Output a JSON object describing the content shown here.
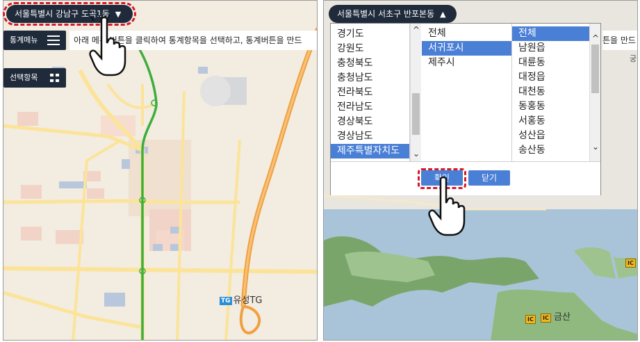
{
  "left": {
    "location_pill": "서울특별시 강남구 도곡1동",
    "location_toggle": "▼",
    "stats_menu_label": "통계메뉴",
    "info_text": "아래 메뉴 버튼을 클릭하여 통계항목을 선택하고, 통계버튼을 만드",
    "select_items_label": "선택항목",
    "tg_badge": "TG",
    "tg_label": "유성TG"
  },
  "right": {
    "location_pill": "서울특별시 서초구 반포본동",
    "location_toggle": "▲",
    "partial_text": "튼을 만드",
    "partial_text2": "궁",
    "provinces": [
      "경기도",
      "강원도",
      "충청북도",
      "충청남도",
      "전라북도",
      "전라남도",
      "경상북도",
      "경상남도",
      "제주특별자치도"
    ],
    "cities": [
      "전체",
      "서귀포시",
      "제주시"
    ],
    "districts": [
      "전체",
      "남원읍",
      "대륜동",
      "대정읍",
      "대천동",
      "동홍동",
      "서홍동",
      "성산읍",
      "송산동"
    ],
    "confirm_button": "확인",
    "close_button": "닫기",
    "ic_badge": "IC",
    "ic_label": "금산"
  },
  "colors": {
    "dark_navy": "#1f2b3b",
    "select_blue": "#4a7fd6",
    "highlight_red": "#d5192a",
    "highway_green": "#3cae3c",
    "road_orange": "#f0a040",
    "sea_blue": "#a9c4d8"
  }
}
